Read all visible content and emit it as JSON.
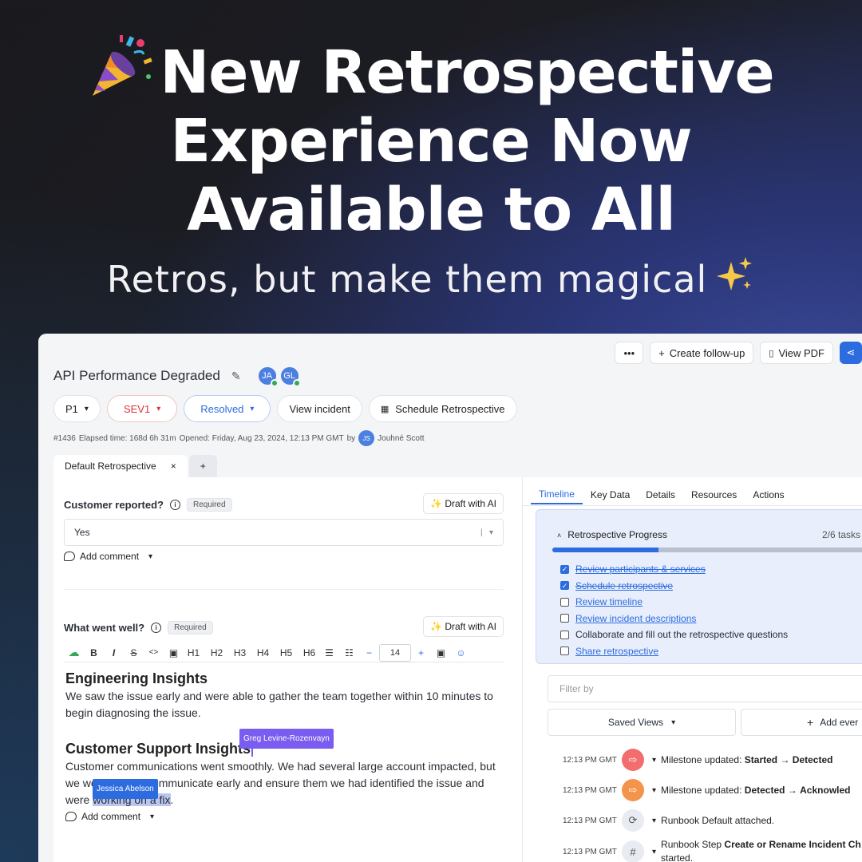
{
  "hero": {
    "title_line1": "New Retrospective",
    "title_line2": "Experience Now",
    "title_line3": "Available to All",
    "subtitle": "Retros, but make them magical",
    "icons": [
      "party-popper-icon",
      "sparkles-icon"
    ]
  },
  "topbar": {
    "more_label": "•••",
    "follow_label": "Create follow-up",
    "pdf_label": "View PDF"
  },
  "incident": {
    "title": "API Performance Degraded",
    "avatars": [
      "JA",
      "GL"
    ],
    "priority": "P1",
    "severity": "SEV1",
    "status": "Resolved",
    "view_incident": "View incident",
    "schedule": "Schedule Retrospective",
    "meta_id": "#1436",
    "meta_elapsed": "Elapsed time: 168d 6h 31m",
    "meta_opened": "Opened: Friday, Aug 23, 2024, 12:13 PM GMT",
    "meta_by": "by",
    "owner_initials": "JS",
    "owner_name": "Jouhné Scott"
  },
  "tabs": {
    "default": "Default Retrospective",
    "close": "×",
    "add": "+"
  },
  "questions": {
    "q1_label": "Customer reported?",
    "required": "Required",
    "draft": "Draft with AI",
    "q1_value": "Yes",
    "add_comment": "Add comment",
    "q2_label": "What went well?"
  },
  "editor_toolbar": [
    "B",
    "I",
    "S",
    "<>",
    "▣",
    "H1",
    "H2",
    "H3",
    "H4",
    "H5",
    "H6",
    "☰",
    "☷",
    "−",
    "14",
    "+"
  ],
  "editor": {
    "h1": "Engineering Insights",
    "p1": "We saw the issue early and were able to gather the team together within 10 minutes to begin diagnosing the issue.",
    "h2": "Customer Support Insights",
    "p2_a": "Customer communications went smoothly. We had several large account impacted, but we were able to communicate early and ensure them we had identified the issue and were ",
    "p2_hl": "working on a fix",
    "p2_end": ".",
    "cursor_greg": "Greg Levine-Rozenvayn",
    "cursor_jessica": "Jessica Abelson"
  },
  "right": {
    "tabs": [
      "Timeline",
      "Key Data",
      "Details",
      "Resources",
      "Actions"
    ],
    "progress_title": "Retrospective Progress",
    "progress_count": "2/6 tasks",
    "progress_fraction": 0.333,
    "tasks": [
      {
        "label": "Review participants & services",
        "done": true,
        "link": true
      },
      {
        "label": "Schedule retrospective",
        "done": true,
        "link": true
      },
      {
        "label": "Review timeline",
        "done": false,
        "link": true
      },
      {
        "label": "Review incident descriptions",
        "done": false,
        "link": true
      },
      {
        "label": "Collaborate and fill out the retrospective questions",
        "done": false,
        "link": false
      },
      {
        "label": "Share retrospective",
        "done": false,
        "link": true
      }
    ],
    "filter_placeholder": "Filter by",
    "saved_views": "Saved Views",
    "add_event": "Add ever"
  },
  "timeline": [
    {
      "time": "12:13 PM GMT",
      "icon": "milestone-icon",
      "text_a": "Milestone updated: ",
      "bold_a": "Started",
      "text_b": " → ",
      "bold_b": "Detected",
      "color": "#f26d6d"
    },
    {
      "time": "12:13 PM GMT",
      "icon": "milestone-icon",
      "text_a": "Milestone updated: ",
      "bold_a": "Detected",
      "text_b": " → ",
      "bold_b": "Acknowled",
      "color": "#f4934a"
    },
    {
      "time": "12:13 PM GMT",
      "icon": "runbook-icon",
      "text_a": "Runbook Default attached.",
      "bold_a": "",
      "text_b": "",
      "bold_b": "",
      "color": "#e8ebf1"
    },
    {
      "time": "12:13 PM GMT",
      "icon": "slack-icon",
      "text_a": "Runbook Step ",
      "bold_a": "Create or Rename Incident Ch",
      "text_b": "",
      "bold_b": "",
      "text_c": "started.",
      "color": "#e8ebf1"
    }
  ]
}
